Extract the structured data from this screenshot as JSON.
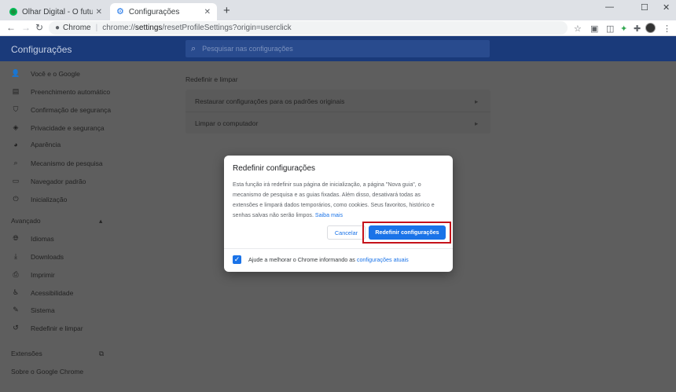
{
  "tabs": [
    {
      "title": "Olhar Digital - O futuro passa p…",
      "close": "✕"
    },
    {
      "title": "Configurações",
      "close": "✕"
    }
  ],
  "new_tab": "+",
  "window_controls": {
    "minimize": "—",
    "maximize": "☐",
    "close": "✕"
  },
  "omnibox": {
    "scheme": "Chrome",
    "separator": "|",
    "url_prefix": "chrome://",
    "url_bold": "settings",
    "url_suffix": "/resetProfileSettings?origin=userclick"
  },
  "settings": {
    "title": "Configurações",
    "search_placeholder": "Pesquisar nas configurações",
    "sidebar": {
      "items": [
        {
          "label": "Você e o Google",
          "icon": "person-icon"
        },
        {
          "label": "Preenchimento automático",
          "icon": "clipboard-icon"
        },
        {
          "label": "Confirmação de segurança",
          "icon": "shield-icon"
        },
        {
          "label": "Privacidade e segurança",
          "icon": "shield-lock-icon"
        },
        {
          "label": "Aparência",
          "icon": "palette-icon"
        },
        {
          "label": "Mecanismo de pesquisa",
          "icon": "search-icon"
        },
        {
          "label": "Navegador padrão",
          "icon": "browser-icon"
        },
        {
          "label": "Inicialização",
          "icon": "power-icon"
        }
      ],
      "advanced_label": "Avançado",
      "advanced_items": [
        {
          "label": "Idiomas",
          "icon": "globe-icon"
        },
        {
          "label": "Downloads",
          "icon": "download-icon"
        },
        {
          "label": "Imprimir",
          "icon": "printer-icon"
        },
        {
          "label": "Acessibilidade",
          "icon": "accessibility-icon"
        },
        {
          "label": "Sistema",
          "icon": "wrench-icon"
        },
        {
          "label": "Redefinir e limpar",
          "icon": "history-icon"
        }
      ],
      "extensions_label": "Extensões",
      "about_label": "Sobre o Google Chrome"
    },
    "section_title": "Redefinir e limpar",
    "rows": [
      "Restaurar configurações para os padrões originais",
      "Limpar o computador"
    ]
  },
  "dialog": {
    "title": "Redefinir configurações",
    "body": "Esta função irá redefinir sua página de inicialização, a página \"Nova guia\", o mecanismo de pesquisa e as guias fixadas. Além disso, desativará todas as extensões e limpará dados temporários, como cookies. Seus favoritos, histórico e senhas salvas não serão limpos.",
    "learn_more": "Saiba mais",
    "cancel": "Cancelar",
    "confirm": "Redefinir configurações",
    "footer_text": "Ajude a melhorar o Chrome informando as",
    "footer_link": "configurações atuais",
    "checkbox_checked": true
  },
  "colors": {
    "accent": "#1a73e8",
    "highlight": "#c5121b",
    "header": "#1a3a7a"
  }
}
